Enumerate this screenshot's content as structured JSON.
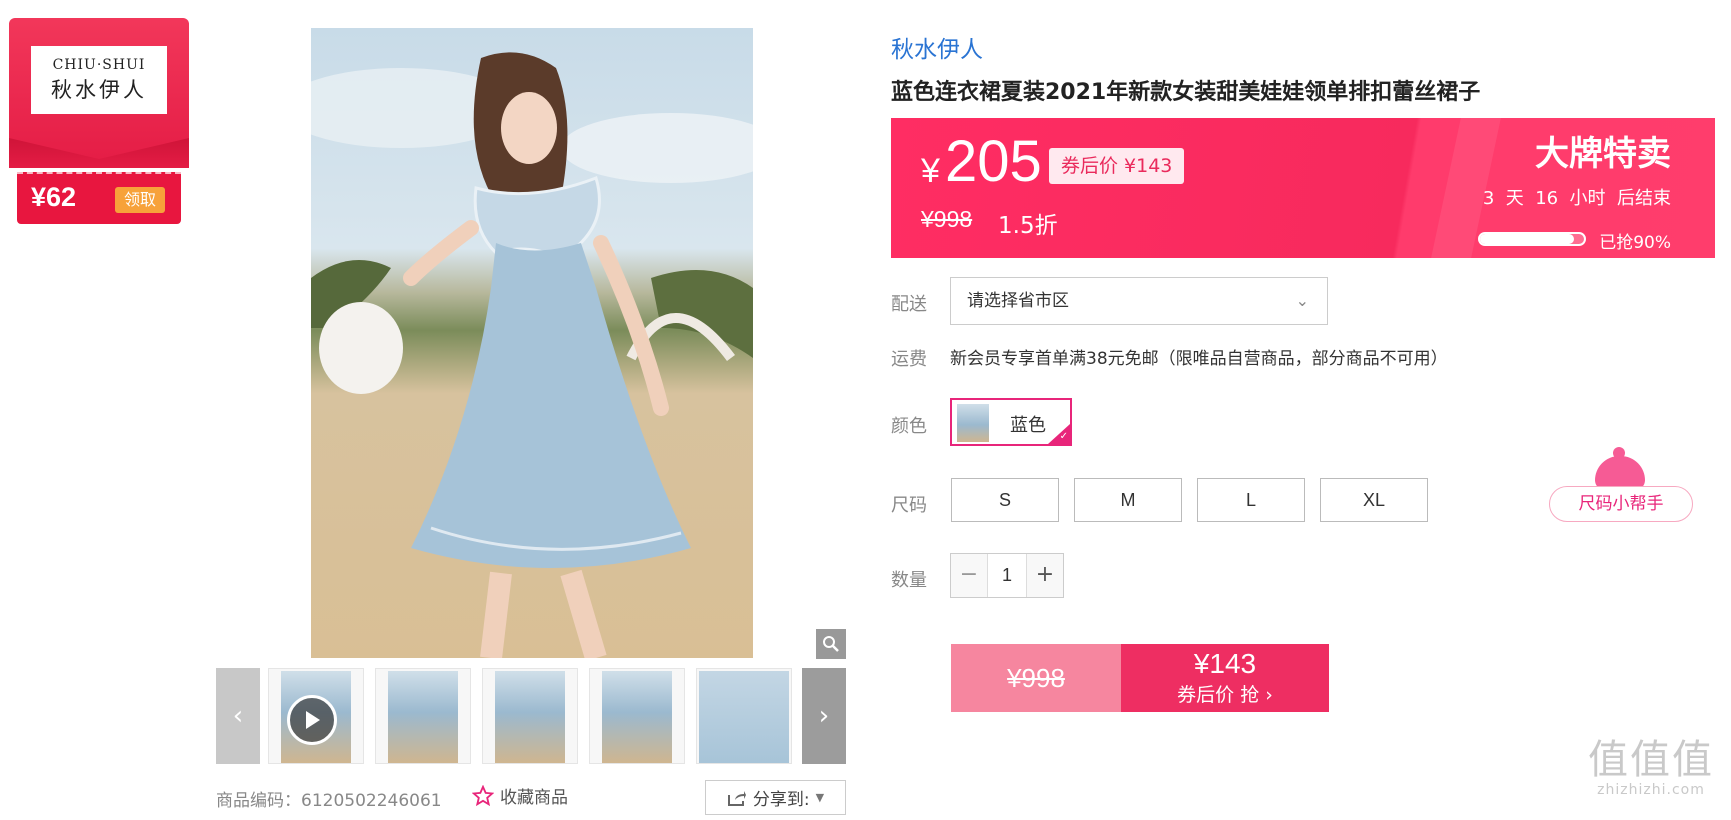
{
  "brand_card": {
    "logo_en": "CHIU·SHUI",
    "logo_zh": "秋水伊人",
    "coupon_amount": "¥62",
    "claim_label": "领取"
  },
  "gallery": {
    "share_label": "分享到:",
    "sku_label": "商品编码：6120502246061",
    "favorite_label": "收藏商品",
    "thumbnail_count": 5
  },
  "product": {
    "brand": "秋水伊人",
    "title": "蓝色连衣裙夏装2021年新款女装甜美娃娃领单排扣蕾丝裙子"
  },
  "price": {
    "yen": "¥",
    "current": "205",
    "coupon_price": "券后价 ¥143",
    "original": "¥998",
    "discount": "1.5折",
    "sale_title": "大牌特卖",
    "countdown": "3  天  16  小时  后结束",
    "sold_percent": 90,
    "sold_label": "已抢90%"
  },
  "delivery": {
    "label": "配送",
    "select_value": "请选择省市区"
  },
  "shipping": {
    "label": "运费",
    "text": "新会员专享首单满38元免邮（限唯品自营商品，部分商品不可用）"
  },
  "color": {
    "label": "颜色",
    "selected": "蓝色"
  },
  "size": {
    "label": "尺码",
    "options": [
      "S",
      "M",
      "L",
      "XL"
    ],
    "helper": "尺码小帮手"
  },
  "quantity": {
    "label": "数量",
    "minus": "−",
    "value": "1",
    "plus": "+"
  },
  "buy": {
    "original": "¥998",
    "price": "¥143",
    "cta": "券后价 抢 ›"
  },
  "watermark": {
    "big": "值值值",
    "small": "zhizhizhi.com"
  },
  "colors": {
    "accent": "#ff2d63",
    "brand_link": "#2a74d3",
    "selected_border": "#e8257a"
  }
}
